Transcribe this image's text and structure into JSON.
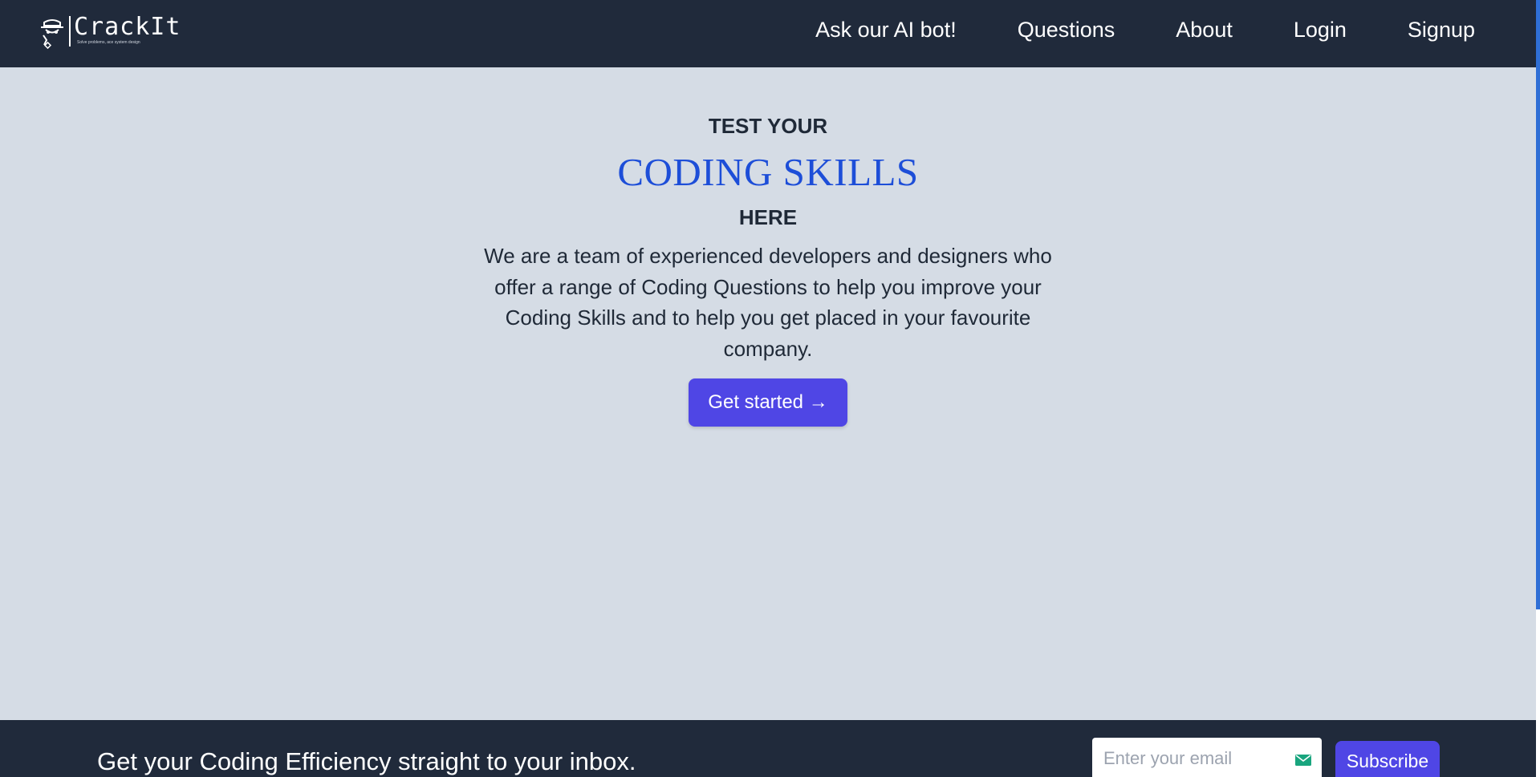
{
  "navbar": {
    "logo": {
      "name": "CrackIt",
      "tagline": "Solve problems, ace system design"
    },
    "links": [
      {
        "label": "Ask our AI bot!"
      },
      {
        "label": "Questions"
      },
      {
        "label": "About"
      },
      {
        "label": "Login"
      },
      {
        "label": "Signup"
      }
    ]
  },
  "hero": {
    "eyebrow": "TEST YOUR",
    "headline": "CODING SKILLS",
    "subline": "HERE",
    "description": "We are a team of experienced developers and designers who offer a range of Coding Questions to help you improve your Coding Skills and to help you get placed in your favourite company.",
    "cta_label": "Get started →"
  },
  "footer": {
    "text": "Get your Coding Efficiency straight to your inbox.",
    "email_placeholder": "Enter your email",
    "email_value": "",
    "subscribe_label": "Subscribe"
  },
  "icons": {
    "logo": "hacker-hat-icon",
    "email": "email-icon"
  },
  "colors": {
    "navbar_bg": "#202a3b",
    "page_bg": "#d5dce5",
    "accent_blue": "#1d4ed8",
    "button_indigo": "#4f46e5",
    "text_dark": "#1f2937",
    "scrollbar": "#2f6fd6"
  }
}
